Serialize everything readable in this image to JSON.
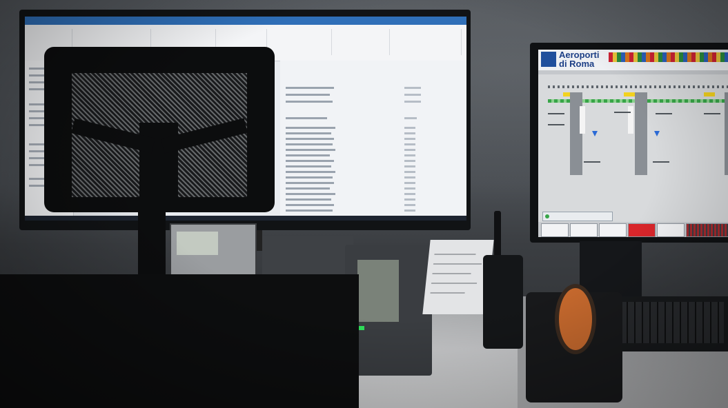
{
  "right_monitor": {
    "logo_line1": "Aeroporti",
    "logo_line2": "di Roma"
  },
  "colors": {
    "wall": "#4f5358",
    "desk": "#cfd0d2",
    "ribbon_blue": "#2f6fb8",
    "status_green": "#38a548",
    "alarm_red": "#d9262b",
    "adr_blue": "#1c3f86"
  }
}
